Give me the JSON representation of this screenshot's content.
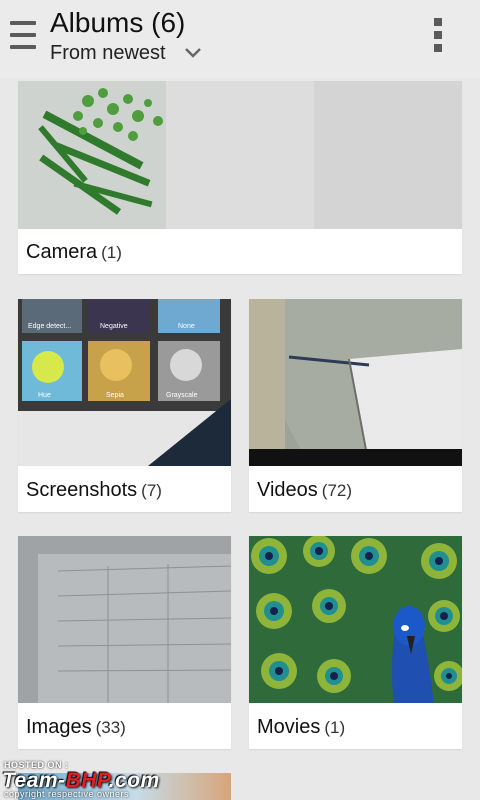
{
  "header": {
    "title": "Albums (6)",
    "sort_label": "From newest",
    "icons": [
      "drawer-menu-icon",
      "chevron-down-icon",
      "overflow-menu-icon"
    ]
  },
  "albums": [
    {
      "name": "Camera",
      "count": "(1)"
    },
    {
      "name": "Screenshots",
      "count": "(7)"
    },
    {
      "name": "Videos",
      "count": "(72)"
    },
    {
      "name": "Images",
      "count": "(33)"
    },
    {
      "name": "Movies",
      "count": "(1)"
    }
  ],
  "screenshot_thumb_labels": [
    "Edge detect...",
    "Negative",
    "None",
    "Hue",
    "Sepia",
    "Grayscale"
  ],
  "watermark": {
    "hosted": "HOSTED ON :",
    "brand_prefix": "Team-",
    "brand_accent": "BHP",
    "brand_suffix": ".com",
    "copyright": "copyright respective owners"
  },
  "colors": {
    "background": "#e8e8e8",
    "card": "#ffffff",
    "icon_gray": "#5a5a5a",
    "watermark_accent": "#e02020"
  }
}
